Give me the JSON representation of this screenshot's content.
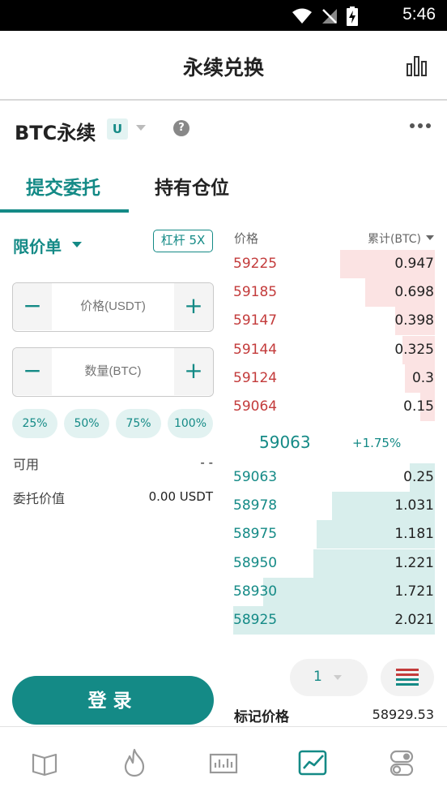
{
  "status_bar": {
    "time": "5:46",
    "icons": [
      "wifi-icon",
      "no-signal-icon",
      "battery-charging-icon"
    ]
  },
  "header": {
    "title": "永续兑换",
    "right_icon": "bar-chart-icon"
  },
  "market": {
    "name": "BTC永续",
    "badge": "U",
    "help": "?",
    "more_icon": "more-horizontal-icon"
  },
  "tabs": [
    {
      "label": "提交委托",
      "active": true
    },
    {
      "label": "持有仓位",
      "active": false
    }
  ],
  "order_form": {
    "order_type": "限价单",
    "leverage": "杠杆 5X",
    "price_placeholder": "价格(USDT)",
    "qty_placeholder": "数量(BTC)",
    "minus": "−",
    "plus": "+",
    "percent_options": [
      "25%",
      "50%",
      "75%",
      "100%"
    ],
    "available_label": "可用",
    "available_value": "- -",
    "order_value_label": "委托价值",
    "order_value": "0.00 USDT",
    "login_label": "登录"
  },
  "order_book": {
    "price_header": "价格",
    "cum_header": "累计(BTC)",
    "asks": [
      {
        "price": "59225",
        "amount": "0.947",
        "depth": 0.947
      },
      {
        "price": "59185",
        "amount": "0.698",
        "depth": 0.698
      },
      {
        "price": "59147",
        "amount": "0.398",
        "depth": 0.398
      },
      {
        "price": "59144",
        "amount": "0.325",
        "depth": 0.325
      },
      {
        "price": "59124",
        "amount": "0.3",
        "depth": 0.3
      },
      {
        "price": "59064",
        "amount": "0.15",
        "depth": 0.15
      }
    ],
    "last_price": "59063",
    "change": "+1.75%",
    "bids": [
      {
        "price": "59063",
        "amount": "0.25",
        "depth": 0.25
      },
      {
        "price": "58978",
        "amount": "1.031",
        "depth": 1.031
      },
      {
        "price": "58975",
        "amount": "1.181",
        "depth": 1.181
      },
      {
        "price": "58950",
        "amount": "1.221",
        "depth": 1.221
      },
      {
        "price": "58930",
        "amount": "1.721",
        "depth": 1.721
      },
      {
        "price": "58925",
        "amount": "2.021",
        "depth": 2.021
      }
    ],
    "depth_precision": "1",
    "mark_price_label": "标记价格",
    "mark_price": "58929.53"
  },
  "colors": {
    "accent": "#148a86",
    "ask": "#c33b3b",
    "ask_bg": "#fbe3e3",
    "bid_bg": "#d8eeec"
  },
  "bottom_nav": [
    {
      "icon": "book-icon",
      "active": false
    },
    {
      "icon": "flame-icon",
      "active": false
    },
    {
      "icon": "bar-chart-icon",
      "active": false
    },
    {
      "icon": "trend-chart-icon",
      "active": true
    },
    {
      "icon": "toggle-settings-icon",
      "active": false
    }
  ]
}
